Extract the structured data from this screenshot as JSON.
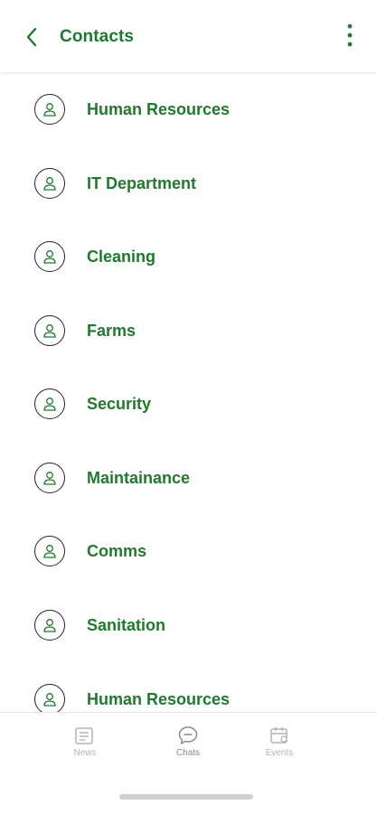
{
  "header": {
    "title": "Contacts",
    "back_icon": "chevron-left-icon",
    "more_icon": "vertical-dots-icon"
  },
  "contacts": [
    {
      "name": "Human Resources"
    },
    {
      "name": "IT Department"
    },
    {
      "name": "Cleaning"
    },
    {
      "name": "Farms"
    },
    {
      "name": "Security"
    },
    {
      "name": "Maintainance"
    },
    {
      "name": "Comms"
    },
    {
      "name": "Sanitation"
    },
    {
      "name": "Human Resources"
    }
  ],
  "bottom_nav": {
    "items": [
      {
        "label": "News",
        "icon": "newspaper-icon"
      },
      {
        "label": "Chats",
        "icon": "chat-bubble-icon",
        "active": true
      },
      {
        "label": "Events",
        "icon": "calendar-icon"
      }
    ]
  },
  "colors": {
    "accent": "#1e7a2c",
    "nav_inactive": "#b4b4b4"
  }
}
